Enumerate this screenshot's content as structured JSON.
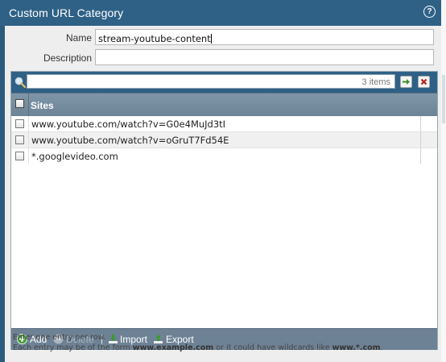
{
  "dialog": {
    "title": "Custom URL Category",
    "help_icon": "help-icon",
    "help_glyph": "?"
  },
  "form": {
    "name_label": "Name",
    "name_value": "stream-youtube-content",
    "description_label": "Description",
    "description_value": ""
  },
  "grid": {
    "search_value": "",
    "item_count": "3 items",
    "column_header": "Sites",
    "rows": [
      {
        "site": "www.youtube.com/watch?v=G0e4MuJd3tI",
        "checked": false
      },
      {
        "site": "www.youtube.com/watch?v=oGruT7Fd54E",
        "checked": false
      },
      {
        "site": "*.googlevideo.com",
        "checked": false
      }
    ]
  },
  "toolbar": {
    "add_label": "Add",
    "delete_label": "Delete",
    "import_label": "Import",
    "export_label": "Export"
  },
  "hint": {
    "line1": "Enter one entry per row.",
    "line2_prefix": "Each entry may be of the form ",
    "example_domain": "www.example.com",
    "line2_middle": " or it could have wildcards like ",
    "wildcard_example": "www.*.com",
    "line2_suffix": "."
  },
  "colors": {
    "title_bar": "#2f6186",
    "header": "#7f95a8",
    "toolbar": "#6e8295",
    "add_green": "#3a9a2e",
    "clear_red": "#b3261e"
  }
}
